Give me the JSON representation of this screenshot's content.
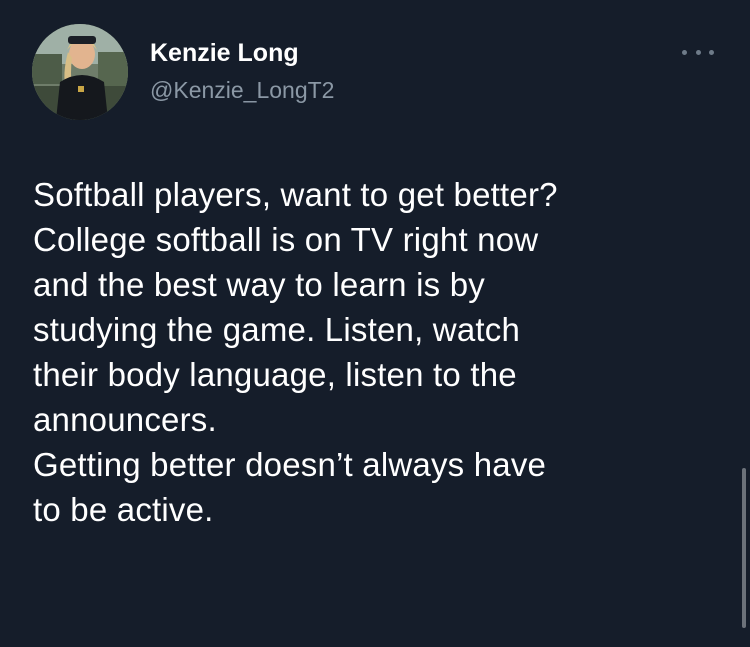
{
  "user": {
    "name": "Kenzie Long",
    "handle": "@Kenzie_LongT2"
  },
  "tweet": {
    "lines": [
      "Softball players, want to get better?",
      "College softball is on TV right now",
      "and the best way to learn is by",
      "studying the game. Listen, watch",
      "their body language, listen to the",
      "announcers.",
      "Getting better doesn’t always have",
      "to be active."
    ]
  },
  "icons": {
    "more": "more-horizontal-icon"
  },
  "colors": {
    "background": "#151d2a",
    "text": "#ffffff",
    "secondary_text": "#8b98a5"
  }
}
